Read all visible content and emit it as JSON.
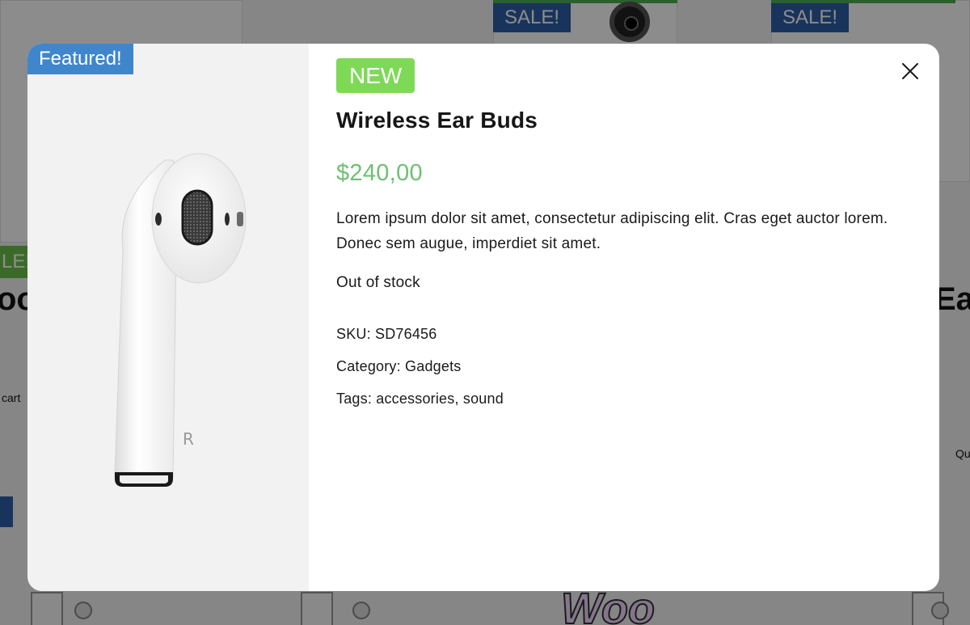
{
  "background": {
    "sale_badge_label": "SALE!",
    "sale_badge_green_label": "LE!",
    "left_title_fragment": "oo",
    "right_title_fragment": "Ear",
    "cart_fragment": "cart",
    "right_fragment": "Qu",
    "woo_logo_text": "Woo"
  },
  "modal": {
    "featured_badge": "Featured!",
    "new_badge": "NEW",
    "product_title": "Wireless Ear Buds",
    "price": "$240,00",
    "description": "Lorem ipsum dolor sit amet, consectetur adipiscing elit. Cras eget auctor lorem. Donec sem augue, imperdiet sit amet.",
    "stock_status": "Out of stock",
    "sku_label": "SKU:",
    "sku_value": "SD76456",
    "category_label": "Category:",
    "category_value": "Gadgets",
    "tags_label": "Tags:",
    "tags": [
      "accessories",
      "sound"
    ],
    "tags_text": "accessories, sound",
    "image_icon": "earbud-image",
    "close_icon": "close-icon",
    "earbud_letter": "R"
  },
  "colors": {
    "featured_badge_bg": "#3f86cc",
    "new_badge_bg": "#7ed957",
    "price": "#6fbf73",
    "sale_badge_bg": "#2f5fa8"
  }
}
